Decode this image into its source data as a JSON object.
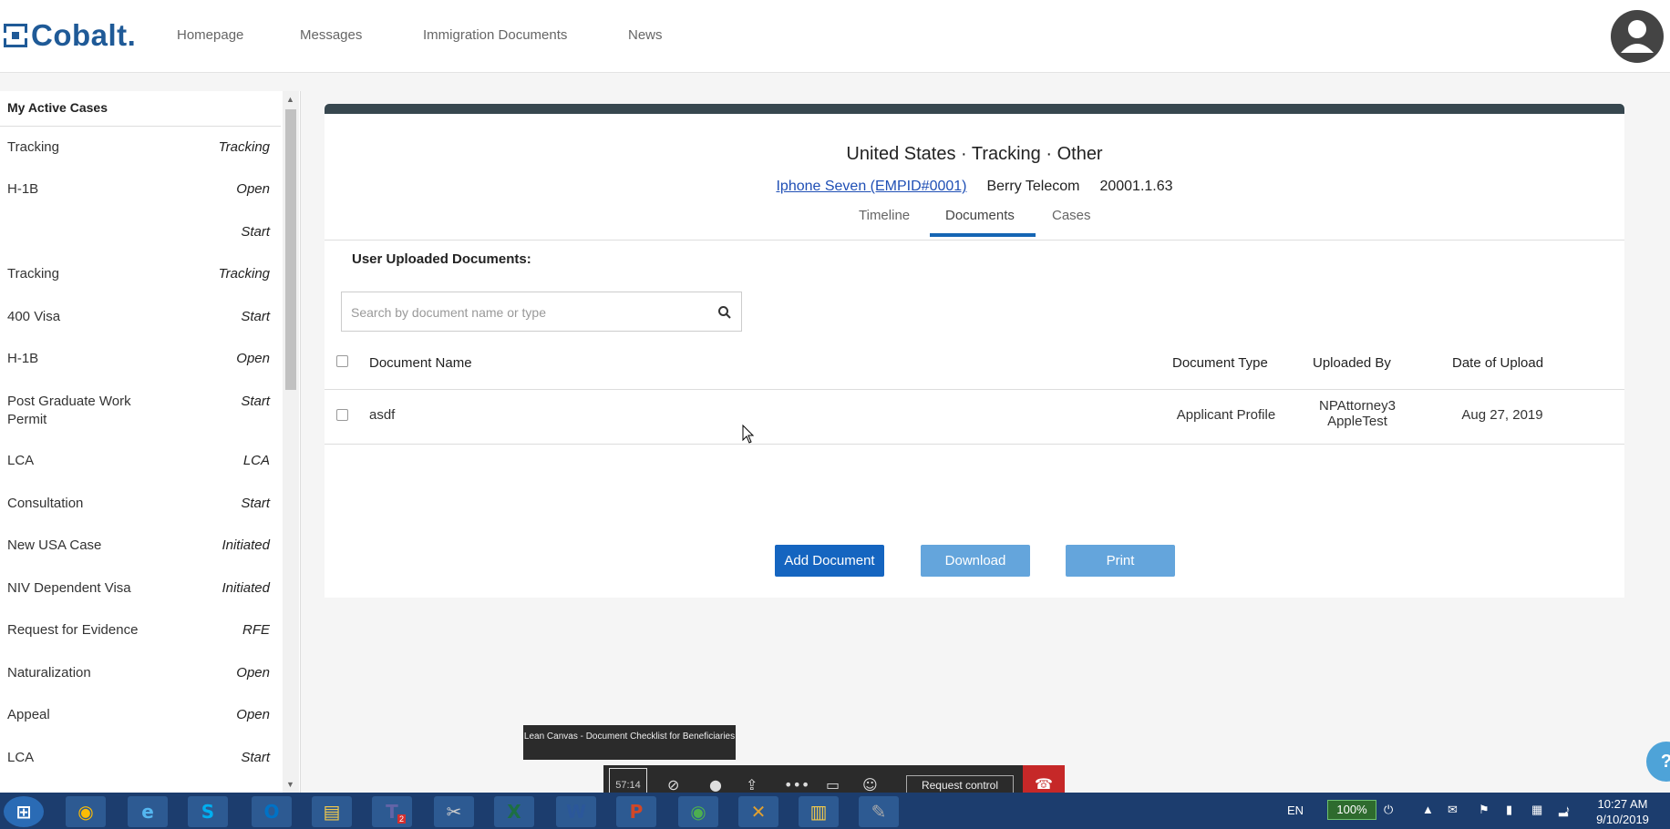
{
  "header": {
    "brand": "Cobalt.",
    "nav": [
      "Homepage",
      "Messages",
      "Immigration Documents",
      "News"
    ]
  },
  "sidebar": {
    "title": "My Active Cases",
    "items": [
      {
        "name": "Tracking",
        "status": "Tracking"
      },
      {
        "name": "H-1B",
        "status": "Open"
      },
      {
        "name": "",
        "status": "Start"
      },
      {
        "name": "Tracking",
        "status": "Tracking"
      },
      {
        "name": "400 Visa",
        "status": "Start"
      },
      {
        "name": "H-1B",
        "status": "Open"
      },
      {
        "name": "Post Graduate Work Permit",
        "status": "Start"
      },
      {
        "name": "LCA",
        "status": "LCA"
      },
      {
        "name": "Consultation",
        "status": "Start"
      },
      {
        "name": "New USA Case",
        "status": "Initiated"
      },
      {
        "name": "NIV Dependent Visa",
        "status": "Initiated"
      },
      {
        "name": "Request for Evidence",
        "status": "RFE"
      },
      {
        "name": "Naturalization",
        "status": "Open"
      },
      {
        "name": "Appeal",
        "status": "Open"
      },
      {
        "name": "LCA",
        "status": "Start"
      }
    ]
  },
  "case": {
    "title": "United States · Tracking · Other",
    "employee_link": "Iphone Seven (EMPID#0001)",
    "company": "Berry Telecom",
    "case_number": "20001.1.63",
    "tabs": [
      "Timeline",
      "Documents",
      "Cases"
    ],
    "active_tab": "Documents"
  },
  "documents": {
    "section_title": "User Uploaded Documents:",
    "search_placeholder": "Search by document name or type",
    "columns": [
      "Document Name",
      "Document Type",
      "Uploaded By",
      "Date of Upload"
    ],
    "rows": [
      {
        "name": "asdf",
        "type": "Applicant Profile",
        "uploaded_by_line1": "NPAttorney3",
        "uploaded_by_line2": "AppleTest",
        "date": "Aug 27, 2019"
      }
    ],
    "buttons": {
      "add": "Add Document",
      "download": "Download",
      "print": "Print"
    }
  },
  "call": {
    "tooltip": "Lean Canvas - Document Checklist for Beneficiaries",
    "timer": "57:14",
    "request_control": "Request control"
  },
  "taskbar": {
    "language": "EN",
    "battery": "100%",
    "time": "10:27 AM",
    "date": "9/10/2019",
    "teams_badge": "2"
  },
  "colors": {
    "brand": "#1f5a97",
    "primary_button": "#1565c0",
    "secondary_button": "#64a5dc",
    "card_header": "#37474f",
    "taskbar": "#1c3d6e"
  }
}
